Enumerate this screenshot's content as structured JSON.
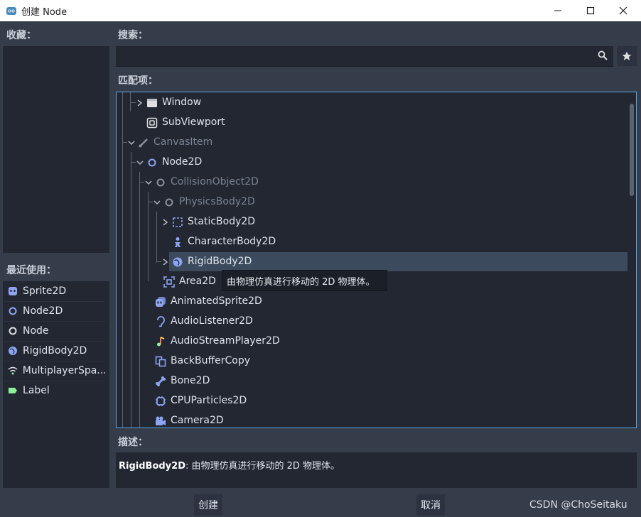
{
  "window": {
    "title": "创建 Node"
  },
  "favorites": {
    "label": "收藏："
  },
  "recent": {
    "label": "最近使用：",
    "items": [
      {
        "label": "Sprite2D",
        "icon": "sprite-icon"
      },
      {
        "label": "Node2D",
        "icon": "node2d-circle-icon"
      },
      {
        "label": "Node",
        "icon": "node-circle-icon"
      },
      {
        "label": "RigidBody2D",
        "icon": "rigidbody-globe-icon"
      },
      {
        "label": "MultiplayerSpa...",
        "icon": "multiplayer-wifi-icon"
      },
      {
        "label": "Label",
        "icon": "label-tag-icon"
      }
    ]
  },
  "search": {
    "label": "搜索：",
    "value": "",
    "placeholder": ""
  },
  "matches": {
    "label": "匹配项：",
    "rows": [
      {
        "label": "Window",
        "icon": "window-icon"
      },
      {
        "label": "SubViewport",
        "icon": "subviewport-icon"
      },
      {
        "label": "CanvasItem",
        "icon": "canvasitem-brush-icon"
      },
      {
        "label": "Node2D",
        "icon": "node2d-circle-icon"
      },
      {
        "label": "CollisionObject2D",
        "icon": "collisionobject-circle-icon"
      },
      {
        "label": "PhysicsBody2D",
        "icon": "physicsbody-circle-icon"
      },
      {
        "label": "StaticBody2D",
        "icon": "staticbody-icon"
      },
      {
        "label": "CharacterBody2D",
        "icon": "characterbody-icon"
      },
      {
        "label": "RigidBody2D",
        "icon": "rigidbody-globe-icon"
      },
      {
        "label": "Area2D",
        "icon": "area2d-icon"
      },
      {
        "label": "AnimatedSprite2D",
        "icon": "animatedsprite-icon"
      },
      {
        "label": "AudioListener2D",
        "icon": "audiolistener-ear-icon"
      },
      {
        "label": "AudioStreamPlayer2D",
        "icon": "audiostreamplayer-note-icon"
      },
      {
        "label": "BackBufferCopy",
        "icon": "backbuffercopy-icon"
      },
      {
        "label": "Bone2D",
        "icon": "bone-icon"
      },
      {
        "label": "CPUParticles2D",
        "icon": "cpuparticles-icon"
      },
      {
        "label": "Camera2D",
        "icon": "camera-icon"
      }
    ]
  },
  "tooltip": {
    "text": "由物理仿真进行移动的 2D 物理体。"
  },
  "description": {
    "label": "描述：",
    "name": "RigidBody2D",
    "text": ": 由物理仿真进行移动的 2D 物理体。"
  },
  "buttons": {
    "create": "创建",
    "cancel": "取消"
  },
  "watermark": "CSDN @ChoSeitaku",
  "colors": {
    "selection": "#3b4a5c",
    "accent_border": "#5ca8e8",
    "node2d_blue": "#8da5f3",
    "panel_bg": "#222732",
    "window_bg": "#363d4a"
  }
}
